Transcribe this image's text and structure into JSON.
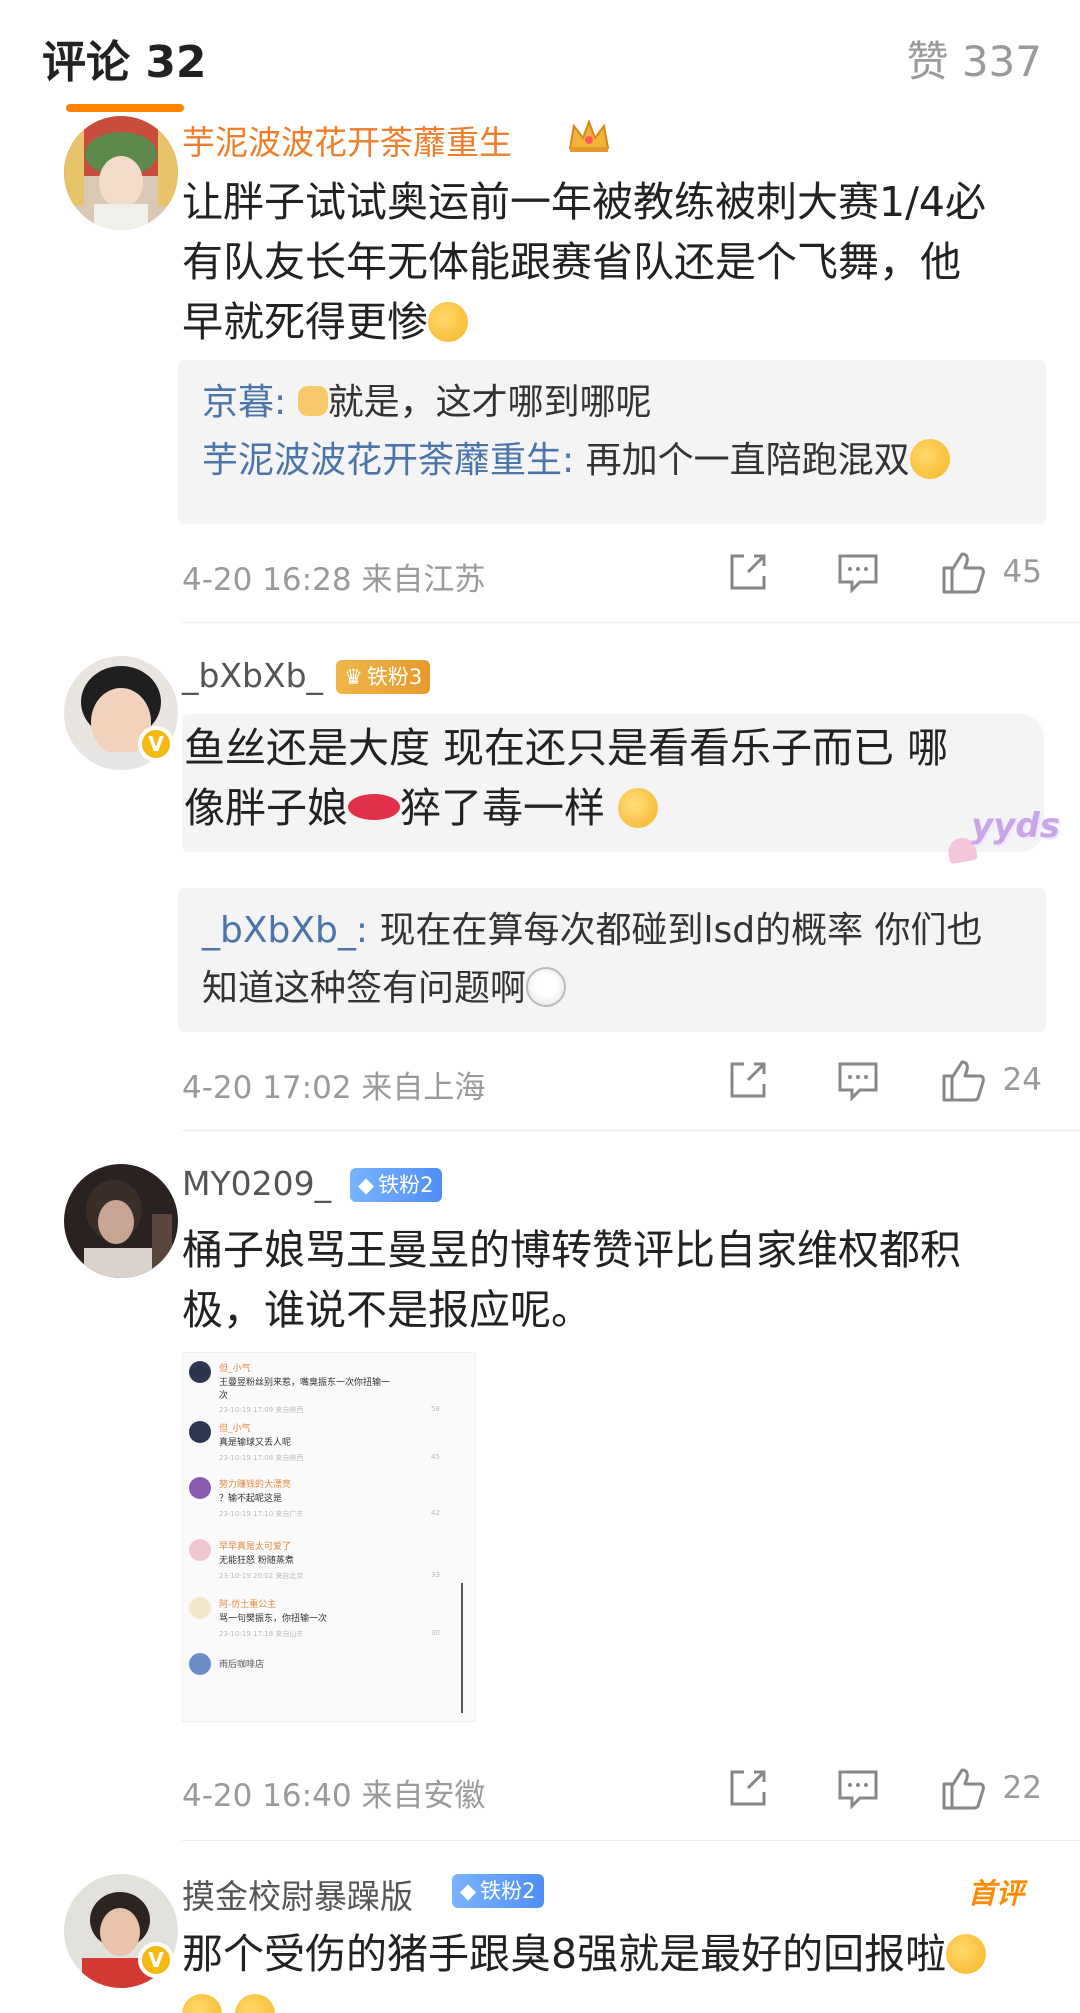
{
  "header": {
    "comments_label": "评论 32",
    "likes_label": "赞 337",
    "accent_color": "#ff8200"
  },
  "comments": [
    {
      "username": "芋泥波波花开荼蘼重生",
      "crown_icon": "crown-icon",
      "text_line1": "让胖子试试奥运前一年被教练被刺大赛1/4必",
      "text_line2": "有队友长年无体能跟赛省队还是个飞舞，他",
      "text_line3": "早就死得更惨",
      "emoji": "tongue-emoji",
      "replies": [
        {
          "name": "京暮",
          "sep": ":",
          "text": "就是，这才哪到哪呢"
        },
        {
          "name": "芋泥波波花开荼蘼重生",
          "sep": ":",
          "text": "再加个一直陪跑混双"
        }
      ],
      "time": "4-20 16:28 来自江苏",
      "likes": "45"
    },
    {
      "username": "_bXbXb_",
      "fan_badge": "铁粉3",
      "text_line1": "鱼丝还是大度 现在还只是看看乐子而已 哪",
      "text_line2_a": "像胖子娘",
      "text_line2_b": "猝了毒一样",
      "sticker": "yyds",
      "replies": [
        {
          "name": "_bXbXb_",
          "sep": ":",
          "text_line1": "现在在算每次都碰到lsd的概率 你们也",
          "text_line2": "知道这种签有问题啊"
        }
      ],
      "time": "4-20 17:02 来自上海",
      "likes": "24"
    },
    {
      "username": "MY0209_",
      "fan_badge": "铁粉2",
      "text_line1": "桶子娘骂王曼昱的博转赞评比自家维权都积",
      "text_line2": "极，谁说不是报应呢。",
      "screenshot": {
        "rows": [
          {
            "name": "但_小气",
            "text": "王曼昱粉丝别来惹，嘴臭振东一次你扭输一",
            "text2": "次",
            "meta": "23-10-19 17:09 来自陕西",
            "likes": "58"
          },
          {
            "name": "但_小气",
            "text": "真是输球又丢人呢",
            "meta": "23-10-19 17:08 来自陕西",
            "likes": "45"
          },
          {
            "name": "努力赚钱的大漂亮",
            "text": "？输不起呢这是",
            "meta": "23-10-19 17:10 来自广东",
            "likes": "42"
          },
          {
            "name": "早早真是太可爱了",
            "text": "无能狂怒 粉随蒸煮",
            "meta": "23-10-19 20:02 来自北京",
            "likes": "33"
          },
          {
            "name": "阿-仿土重公主",
            "text": "骂一句樊振东，你扭输一次",
            "meta": "23-10-19 17:18 来自山东",
            "likes": "30"
          },
          {
            "name": "雨后咖啡店",
            "text": "",
            "meta": "",
            "likes": ""
          }
        ]
      },
      "time": "4-20 16:40 来自安徽",
      "likes": "22"
    },
    {
      "username": "摸金校尉暴躁版",
      "fan_badge": "铁粉2",
      "first_tag": "首评",
      "text_line1": "那个受伤的猪手跟臭8强就是最好的回报啦"
    }
  ]
}
